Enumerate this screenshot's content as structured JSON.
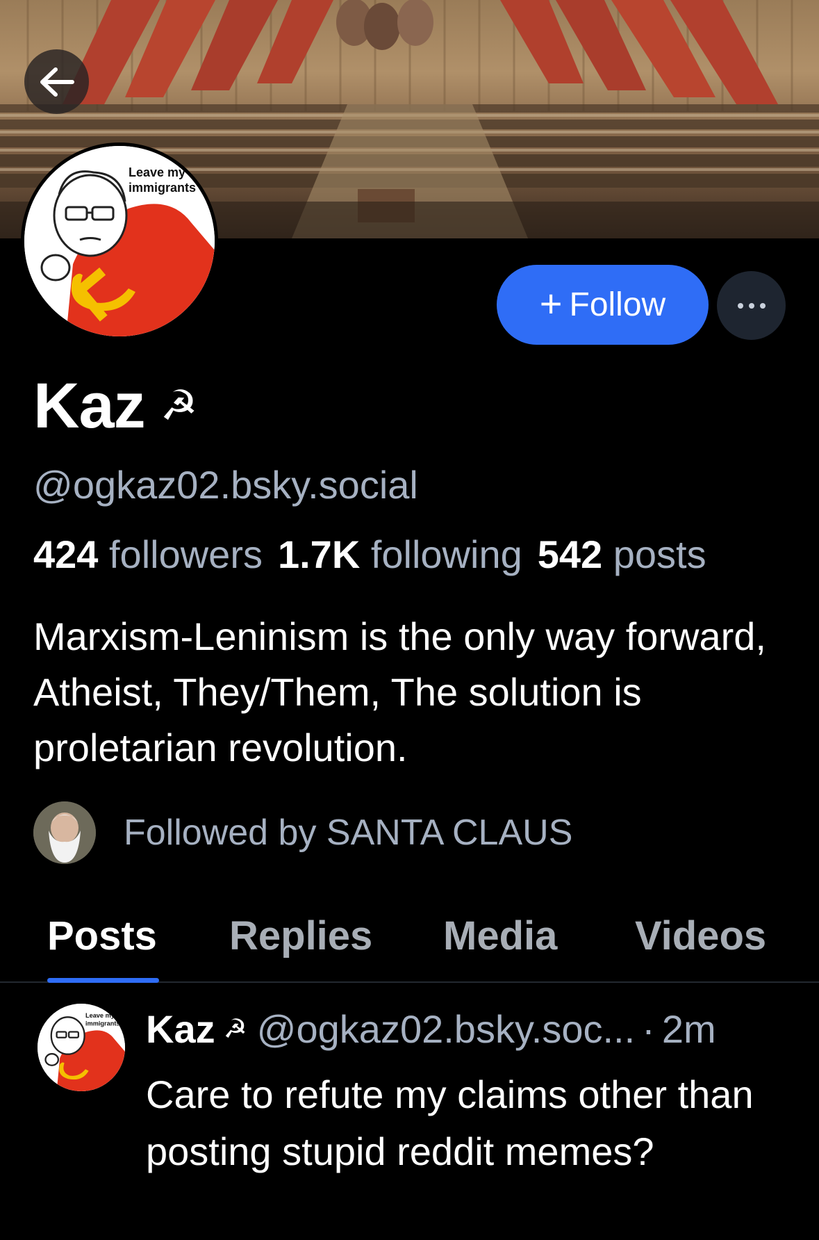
{
  "banner": {
    "image_text": ""
  },
  "avatar": {
    "meme_text_line1": "Leave my",
    "meme_text_line2": "immigrants"
  },
  "actions": {
    "follow_plus": "+",
    "follow_label": "Follow"
  },
  "profile": {
    "name": "Kaz",
    "name_emoji": "☭",
    "handle": "@ogkaz02.bsky.social",
    "stats": {
      "followers_count": "424",
      "followers_label": "followers",
      "following_count": "1.7K",
      "following_label": "following",
      "posts_count": "542",
      "posts_label": "posts"
    },
    "bio": "Marxism-Leninism is the only way forward, Atheist, They/Them, The solution is proletarian revolution.",
    "followed_by": "Followed by SANTA CLAUS"
  },
  "tabs": [
    {
      "label": "Posts",
      "active": true
    },
    {
      "label": "Replies",
      "active": false
    },
    {
      "label": "Media",
      "active": false
    },
    {
      "label": "Videos",
      "active": false
    }
  ],
  "post": {
    "author_name": "Kaz",
    "author_emoji": "☭",
    "author_handle": "@ogkaz02.bsky.soc...",
    "separator": "·",
    "time": "2m",
    "text": "Care to refute my claims other than posting stupid reddit memes?"
  },
  "colors": {
    "accent": "#2f6df6",
    "background": "#000000",
    "muted_text": "#a6b1c2",
    "more_button_bg": "#1e2530"
  }
}
